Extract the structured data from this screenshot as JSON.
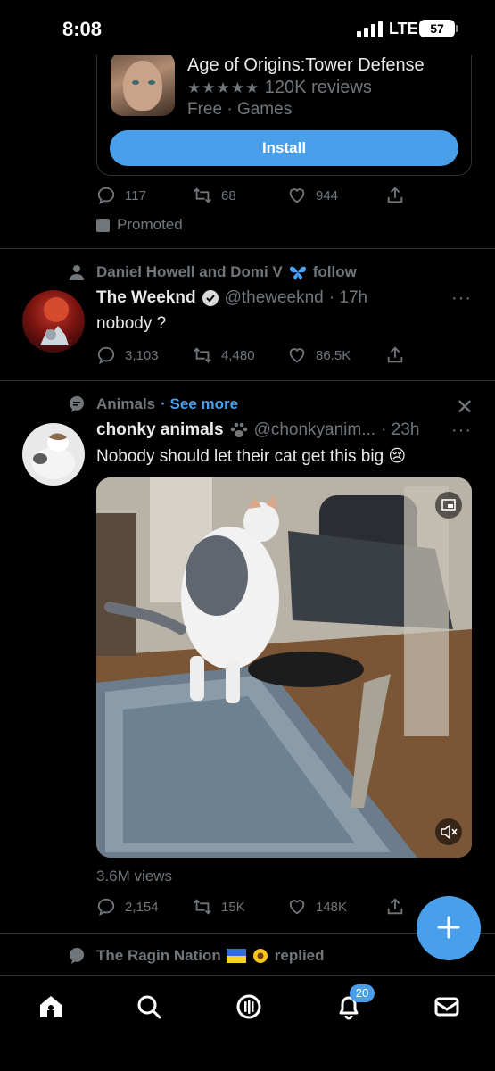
{
  "status_bar": {
    "time": "8:08",
    "network": "LTE",
    "battery": "57"
  },
  "ad": {
    "title": "Age of Origins:Tower Defense",
    "stars": "★★★★★",
    "reviews": "120K reviews",
    "meta": "Free · Games",
    "install_label": "Install",
    "replies": "117",
    "retweets": "68",
    "likes": "944",
    "promoted_label": "Promoted"
  },
  "tweet1": {
    "context": "Daniel Howell and Domi V",
    "context_suffix": "follow",
    "name": "The Weeknd",
    "handle": "@theweeknd",
    "time": "· 17h",
    "text": "nobody ?",
    "replies": "3,103",
    "retweets": "4,480",
    "likes": "86.5K"
  },
  "tweet2": {
    "topic": "Animals",
    "see_more": "· See more",
    "name": "chonky animals",
    "handle": "@chonkyanim...",
    "time": "· 23h",
    "text": "Nobody should let their cat get this big",
    "emoji": "😢",
    "views": "3.6M views",
    "replies": "2,154",
    "retweets": "15K",
    "likes": "148K"
  },
  "tweet3": {
    "context": "The Ragin Nation",
    "context_suffix": "replied"
  },
  "nav": {
    "notifications_badge": "20"
  },
  "colors": {
    "accent": "#4a9fea",
    "muted": "#71767b",
    "background": "#000000"
  }
}
